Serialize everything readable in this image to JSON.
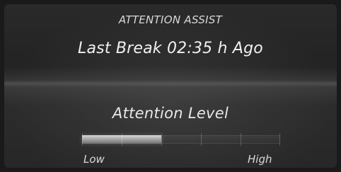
{
  "header": {
    "title": "ATTENTION ASSIST",
    "last_break_text": "Last Break 02:35 h Ago"
  },
  "attention": {
    "title": "Attention Level",
    "low_label": "Low",
    "high_label": "High",
    "level_fraction": 0.4,
    "segments": 5
  },
  "colors": {
    "background": "#232323",
    "text_primary": "#f0f0f0",
    "text_secondary": "#d9d9d9",
    "bar_fill": "#d6d6d6"
  }
}
